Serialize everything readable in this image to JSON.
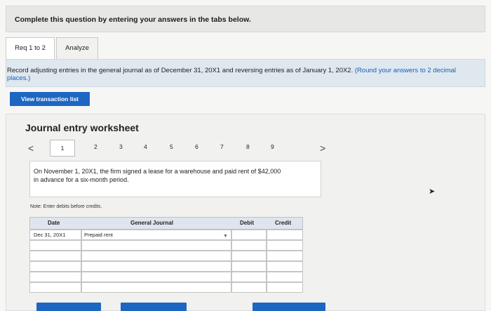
{
  "header": {
    "prompt": "Complete this question by entering your answers in the tabs below."
  },
  "tabs": [
    {
      "label": "Req 1 to 2"
    },
    {
      "label": "Analyze"
    }
  ],
  "instructions": {
    "main": "Record adjusting entries in the general journal as of December 31, 20X1 and reversing entries as of January 1, 20X2.",
    "note": "(Round your answers to 2 decimal places.)"
  },
  "buttons": {
    "view_transactions": "View transaction list"
  },
  "worksheet": {
    "title": "Journal entry worksheet",
    "pages": [
      "1",
      "2",
      "3",
      "4",
      "5",
      "6",
      "7",
      "8",
      "9"
    ],
    "prev_icon": "<",
    "next_icon": ">",
    "description": "On November 1, 20X1, the firm signed a lease for a warehouse and paid rent of $42,000 in advance for a six-month period.",
    "note": "Note: Enter debits before credits."
  },
  "journal": {
    "headers": {
      "date": "Date",
      "account": "General Journal",
      "debit": "Debit",
      "credit": "Credit"
    },
    "rows": [
      {
        "date": "Dec 31, 20X1",
        "account": "Prepaid rent"
      },
      {
        "date": "",
        "account": ""
      },
      {
        "date": "",
        "account": ""
      },
      {
        "date": "",
        "account": ""
      },
      {
        "date": "",
        "account": ""
      },
      {
        "date": "",
        "account": ""
      }
    ]
  },
  "icons": {
    "prev": "chevron-left-icon",
    "next": "chevron-right-icon",
    "dropdown": "chevron-down-icon"
  },
  "colors": {
    "primary_button": "#1d66c2",
    "info_box": "#dfe7ef",
    "table_header": "#dfe5ee"
  }
}
